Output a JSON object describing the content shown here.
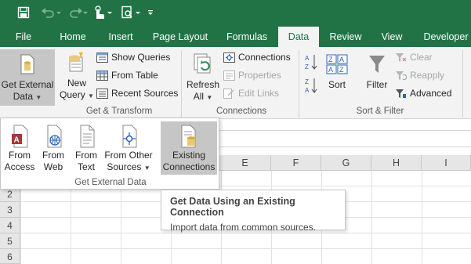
{
  "colors": {
    "accent": "#217346",
    "ribbon_bg": "#f3f3f3",
    "pressed": "#c6c6c6"
  },
  "quick_access": {
    "icons": [
      "save-icon",
      "undo-icon",
      "redo-icon",
      "touch-mode-icon",
      "print-preview-icon",
      "customize-qat-icon"
    ]
  },
  "tabs": [
    {
      "label": "File"
    },
    {
      "label": "Home"
    },
    {
      "label": "Insert"
    },
    {
      "label": "Page Layout"
    },
    {
      "label": "Formulas"
    },
    {
      "label": "Data",
      "active": true
    },
    {
      "label": "Review"
    },
    {
      "label": "View"
    },
    {
      "label": "Developer"
    }
  ],
  "ribbon": {
    "get_external": {
      "line1": "Get External",
      "line2": "Data"
    },
    "new_query": {
      "line1": "New",
      "line2": "Query"
    },
    "show_queries": "Show Queries",
    "from_table": "From Table",
    "recent_sources": "Recent Sources",
    "get_transform_label": "Get & Transform",
    "refresh": {
      "line1": "Refresh",
      "line2": "All"
    },
    "connections": "Connections",
    "properties": "Properties",
    "edit_links": "Edit Links",
    "connections_label": "Connections",
    "sort_az": "A Z",
    "sort": "Sort",
    "filter": "Filter",
    "clear": "Clear",
    "reapply": "Reapply",
    "advanced": "Advanced",
    "sort_filter_label": "Sort & Filter"
  },
  "dropdown": {
    "from_access": {
      "line1": "From",
      "line2": "Access"
    },
    "from_web": {
      "line1": "From",
      "line2": "Web"
    },
    "from_text": {
      "line1": "From",
      "line2": "Text"
    },
    "from_other": {
      "line1": "From Other",
      "line2": "Sources"
    },
    "existing": {
      "line1": "Existing",
      "line2": "Connections"
    },
    "group_label": "Get External Data"
  },
  "grid": {
    "columns": [
      "E",
      "F",
      "G",
      "H",
      "I"
    ],
    "rows": [
      "2",
      "3",
      "4",
      "5",
      "6"
    ]
  },
  "tooltip": {
    "title": "Get Data Using an Existing Connection",
    "description": "Import data from common sources."
  }
}
